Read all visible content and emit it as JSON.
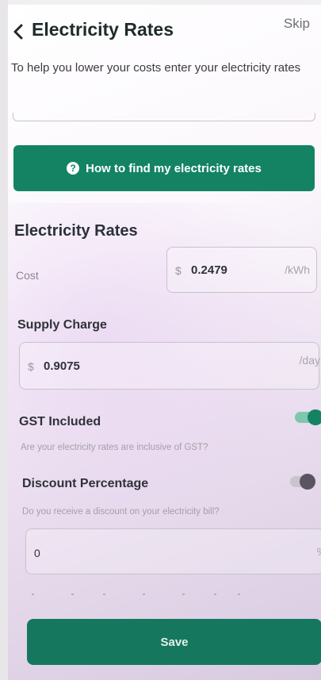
{
  "header": {
    "title": "Electricity Rates",
    "skip_label": "Skip"
  },
  "intro": {
    "text": "To help you lower your costs enter your electricity rates"
  },
  "help_button": {
    "label": "How to find my electricity rates",
    "icon": "question-circle-icon"
  },
  "rates": {
    "section_title": "Electricity Rates",
    "cost": {
      "label": "Cost",
      "currency": "$",
      "value": "0.2479",
      "unit": "/kWh"
    },
    "supply": {
      "label": "Supply Charge",
      "currency": "$",
      "value": "0.9075",
      "unit": "/day"
    }
  },
  "gst": {
    "label": "GST Included",
    "description": "Are your electricity rates are inclusive of GST?",
    "enabled": true
  },
  "discount": {
    "label": "Discount Percentage",
    "description": "Do you receive a discount on your electricity bill?",
    "enabled": false,
    "value": "0",
    "unit": "%"
  },
  "save_button": {
    "label": "Save"
  },
  "colors": {
    "primary": "#138364",
    "save": "#15775e",
    "text": "#2e3238"
  }
}
